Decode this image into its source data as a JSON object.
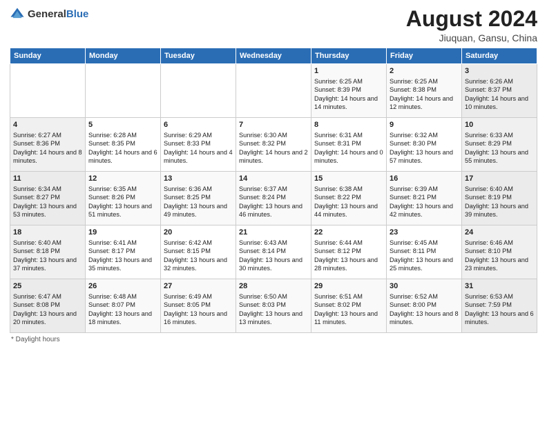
{
  "header": {
    "logo_general": "General",
    "logo_blue": "Blue",
    "main_title": "August 2024",
    "subtitle": "Jiuquan, Gansu, China"
  },
  "calendar": {
    "days_of_week": [
      "Sunday",
      "Monday",
      "Tuesday",
      "Wednesday",
      "Thursday",
      "Friday",
      "Saturday"
    ],
    "weeks": [
      [
        {
          "day": "",
          "content": ""
        },
        {
          "day": "",
          "content": ""
        },
        {
          "day": "",
          "content": ""
        },
        {
          "day": "",
          "content": ""
        },
        {
          "day": "1",
          "content": "Sunrise: 6:25 AM\nSunset: 8:39 PM\nDaylight: 14 hours and 14 minutes."
        },
        {
          "day": "2",
          "content": "Sunrise: 6:25 AM\nSunset: 8:38 PM\nDaylight: 14 hours and 12 minutes."
        },
        {
          "day": "3",
          "content": "Sunrise: 6:26 AM\nSunset: 8:37 PM\nDaylight: 14 hours and 10 minutes."
        }
      ],
      [
        {
          "day": "4",
          "content": "Sunrise: 6:27 AM\nSunset: 8:36 PM\nDaylight: 14 hours and 8 minutes."
        },
        {
          "day": "5",
          "content": "Sunrise: 6:28 AM\nSunset: 8:35 PM\nDaylight: 14 hours and 6 minutes."
        },
        {
          "day": "6",
          "content": "Sunrise: 6:29 AM\nSunset: 8:33 PM\nDaylight: 14 hours and 4 minutes."
        },
        {
          "day": "7",
          "content": "Sunrise: 6:30 AM\nSunset: 8:32 PM\nDaylight: 14 hours and 2 minutes."
        },
        {
          "day": "8",
          "content": "Sunrise: 6:31 AM\nSunset: 8:31 PM\nDaylight: 14 hours and 0 minutes."
        },
        {
          "day": "9",
          "content": "Sunrise: 6:32 AM\nSunset: 8:30 PM\nDaylight: 13 hours and 57 minutes."
        },
        {
          "day": "10",
          "content": "Sunrise: 6:33 AM\nSunset: 8:29 PM\nDaylight: 13 hours and 55 minutes."
        }
      ],
      [
        {
          "day": "11",
          "content": "Sunrise: 6:34 AM\nSunset: 8:27 PM\nDaylight: 13 hours and 53 minutes."
        },
        {
          "day": "12",
          "content": "Sunrise: 6:35 AM\nSunset: 8:26 PM\nDaylight: 13 hours and 51 minutes."
        },
        {
          "day": "13",
          "content": "Sunrise: 6:36 AM\nSunset: 8:25 PM\nDaylight: 13 hours and 49 minutes."
        },
        {
          "day": "14",
          "content": "Sunrise: 6:37 AM\nSunset: 8:24 PM\nDaylight: 13 hours and 46 minutes."
        },
        {
          "day": "15",
          "content": "Sunrise: 6:38 AM\nSunset: 8:22 PM\nDaylight: 13 hours and 44 minutes."
        },
        {
          "day": "16",
          "content": "Sunrise: 6:39 AM\nSunset: 8:21 PM\nDaylight: 13 hours and 42 minutes."
        },
        {
          "day": "17",
          "content": "Sunrise: 6:40 AM\nSunset: 8:19 PM\nDaylight: 13 hours and 39 minutes."
        }
      ],
      [
        {
          "day": "18",
          "content": "Sunrise: 6:40 AM\nSunset: 8:18 PM\nDaylight: 13 hours and 37 minutes."
        },
        {
          "day": "19",
          "content": "Sunrise: 6:41 AM\nSunset: 8:17 PM\nDaylight: 13 hours and 35 minutes."
        },
        {
          "day": "20",
          "content": "Sunrise: 6:42 AM\nSunset: 8:15 PM\nDaylight: 13 hours and 32 minutes."
        },
        {
          "day": "21",
          "content": "Sunrise: 6:43 AM\nSunset: 8:14 PM\nDaylight: 13 hours and 30 minutes."
        },
        {
          "day": "22",
          "content": "Sunrise: 6:44 AM\nSunset: 8:12 PM\nDaylight: 13 hours and 28 minutes."
        },
        {
          "day": "23",
          "content": "Sunrise: 6:45 AM\nSunset: 8:11 PM\nDaylight: 13 hours and 25 minutes."
        },
        {
          "day": "24",
          "content": "Sunrise: 6:46 AM\nSunset: 8:10 PM\nDaylight: 13 hours and 23 minutes."
        }
      ],
      [
        {
          "day": "25",
          "content": "Sunrise: 6:47 AM\nSunset: 8:08 PM\nDaylight: 13 hours and 20 minutes."
        },
        {
          "day": "26",
          "content": "Sunrise: 6:48 AM\nSunset: 8:07 PM\nDaylight: 13 hours and 18 minutes."
        },
        {
          "day": "27",
          "content": "Sunrise: 6:49 AM\nSunset: 8:05 PM\nDaylight: 13 hours and 16 minutes."
        },
        {
          "day": "28",
          "content": "Sunrise: 6:50 AM\nSunset: 8:03 PM\nDaylight: 13 hours and 13 minutes."
        },
        {
          "day": "29",
          "content": "Sunrise: 6:51 AM\nSunset: 8:02 PM\nDaylight: 13 hours and 11 minutes."
        },
        {
          "day": "30",
          "content": "Sunrise: 6:52 AM\nSunset: 8:00 PM\nDaylight: 13 hours and 8 minutes."
        },
        {
          "day": "31",
          "content": "Sunrise: 6:53 AM\nSunset: 7:59 PM\nDaylight: 13 hours and 6 minutes."
        }
      ]
    ]
  },
  "footer": {
    "note": "Daylight hours"
  }
}
